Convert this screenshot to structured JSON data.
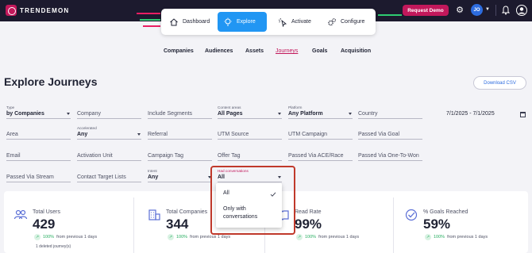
{
  "header": {
    "brand": "TRENDEMON",
    "request_demo": "Request Demo",
    "avatar_initials": "JO",
    "brand_color": "#c2185b",
    "accent_color": "#2196f3",
    "icons": [
      "gear-icon",
      "bell-icon",
      "profile-icon"
    ]
  },
  "main_nav": {
    "items": [
      {
        "label": "Dashboard",
        "icon": "house-icon"
      },
      {
        "label": "Explore",
        "icon": "lightbulb-icon",
        "active": true
      },
      {
        "label": "Activate",
        "icon": "cursor-click-icon"
      },
      {
        "label": "Configure",
        "icon": "gears-icon"
      }
    ]
  },
  "sub_nav": {
    "items": [
      "Companies",
      "Audiences",
      "Assets",
      "Journeys",
      "Goals",
      "Acquisition"
    ],
    "active": "Journeys"
  },
  "page": {
    "title": "Explore Journeys",
    "download_label": "Download CSV"
  },
  "filters": {
    "type": {
      "label": "Type",
      "value": "by Companies"
    },
    "company": {
      "placeholder": "Company"
    },
    "include_segments": {
      "placeholder": "Include Segments"
    },
    "content_areas": {
      "label": "Content areas",
      "value": "All Pages"
    },
    "platform": {
      "label": "Platform",
      "value": "Any Platform"
    },
    "country": {
      "placeholder": "Country"
    },
    "date_range": "7/1/2025 - 7/1/2025",
    "area": {
      "placeholder": "Area"
    },
    "accelerated": {
      "label": "Accelerated",
      "value": "Any"
    },
    "referral": {
      "placeholder": "Referral"
    },
    "utm_source": {
      "placeholder": "UTM Source"
    },
    "utm_campaign": {
      "placeholder": "UTM Campaign"
    },
    "passed_via_goal": {
      "placeholder": "Passed Via Goal"
    },
    "email": {
      "placeholder": "Email"
    },
    "activation_unit": {
      "placeholder": "Activation Unit"
    },
    "campaign_tag": {
      "placeholder": "Campaign Tag"
    },
    "offer_tag": {
      "placeholder": "Offer Tag"
    },
    "passed_via_ace": {
      "placeholder": "Passed Via ACE/Race"
    },
    "passed_via_one_to_won": {
      "placeholder": "Passed Via One-To-Won"
    },
    "passed_via_stream": {
      "placeholder": "Passed Via Stream"
    },
    "contact_target_lists": {
      "placeholder": "Contact Target Lists"
    },
    "intent": {
      "label": "Intent",
      "value": "Any"
    },
    "had_conversations": {
      "label": "Had conversations",
      "value": "All",
      "options": [
        {
          "label": "All",
          "selected": true
        },
        {
          "label": "Only with conversations",
          "selected": false
        }
      ]
    }
  },
  "stats": [
    {
      "label": "Total Users",
      "value": "429",
      "change": "100%",
      "change_suffix": "from previous 1 days",
      "note": "1 deleted journey(s)",
      "icon": "users-icon"
    },
    {
      "label": "Total Companies",
      "value": "344",
      "change": "100%",
      "change_suffix": "from previous 1 days",
      "icon": "building-icon"
    },
    {
      "label": "Read Rate",
      "value": "99%",
      "change": "100%",
      "change_suffix": "from previous 1 days",
      "icon": "book-icon"
    },
    {
      "label": "% Goals Reached",
      "value": "59%",
      "change": "100%",
      "change_suffix": "from previous 1 days",
      "icon": "target-icon"
    }
  ]
}
